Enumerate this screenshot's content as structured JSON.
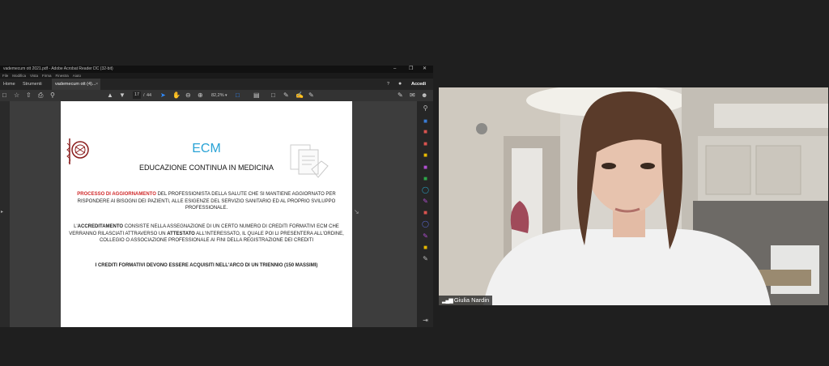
{
  "acrobat": {
    "title": "vademecum ott 2021.pdf - Adobe Acrobat Reader DC (32-bit)",
    "window_controls": {
      "minimize": "–",
      "restore": "❐",
      "close": "✕"
    },
    "menu": [
      "File",
      "Modifica",
      "Vista",
      "Firma",
      "Finestra",
      "Aiuto"
    ],
    "tabs": {
      "home": "Home",
      "tools": "Strumenti",
      "doc": "vademecum ott (4)...",
      "close": "×"
    },
    "help_icon": "?",
    "accedi": "Accedi",
    "toolbar": {
      "page_current": "17",
      "page_sep": "/",
      "page_total": "44",
      "zoom": "82,2%"
    }
  },
  "pdf_page": {
    "heading": "ECM",
    "subheading": "EDUCAZIONE CONTINUA IN MEDICINA",
    "p1_red": "PROCESSO DI AGGIORNAMENTO",
    "p1_rest1": " DEL  PROFESSIONISTA DELLA SALUTE CHE SI MANTIENE AGGIORNATO PER",
    "p1_line2": "RISPONDERE AI BISOGNI DEI PAZIENTI, ALLE ESIGENZE DEL SERVIZIO SANITARIO ED AL PROPRIO SVILUPPO",
    "p1_line3": "PROFESSIONALE.",
    "p2_pre": "L'",
    "p2_bold": "ACCREDITAMENTO",
    "p2_rest1": " CONSISTE NELLA ASSEGNAZIONE DI UN CERTO NUMERO DI CREDITI FORMATIVI ECM CHE",
    "p2_l2a": "VERRANNO RILASCIATI ATTRAVERSO UN ",
    "p2_l2b": "ATTESTATO",
    "p2_l2c": " ALL'INTERESSATO, IL QUALE POI LI PRESENTERA ALL'ORDINE,",
    "p2_line3": "COLLEGIO O ASSOCIAZIONE PROFESSIONALE AI FINI DELLA REGISTRAZIONE DEI CREDITI",
    "p3": "I CREDITI FORMATIVI DEVONO ESSERE ACQUISITI NELL'ARCO DI UN TRIENNIO (150 MASSIMI)"
  },
  "video": {
    "participant_name": "Giulia Nardin"
  },
  "colors": {
    "ecm_blue": "#29a3d6",
    "red": "#d0292a",
    "accent_blue": "#2f8bff"
  }
}
